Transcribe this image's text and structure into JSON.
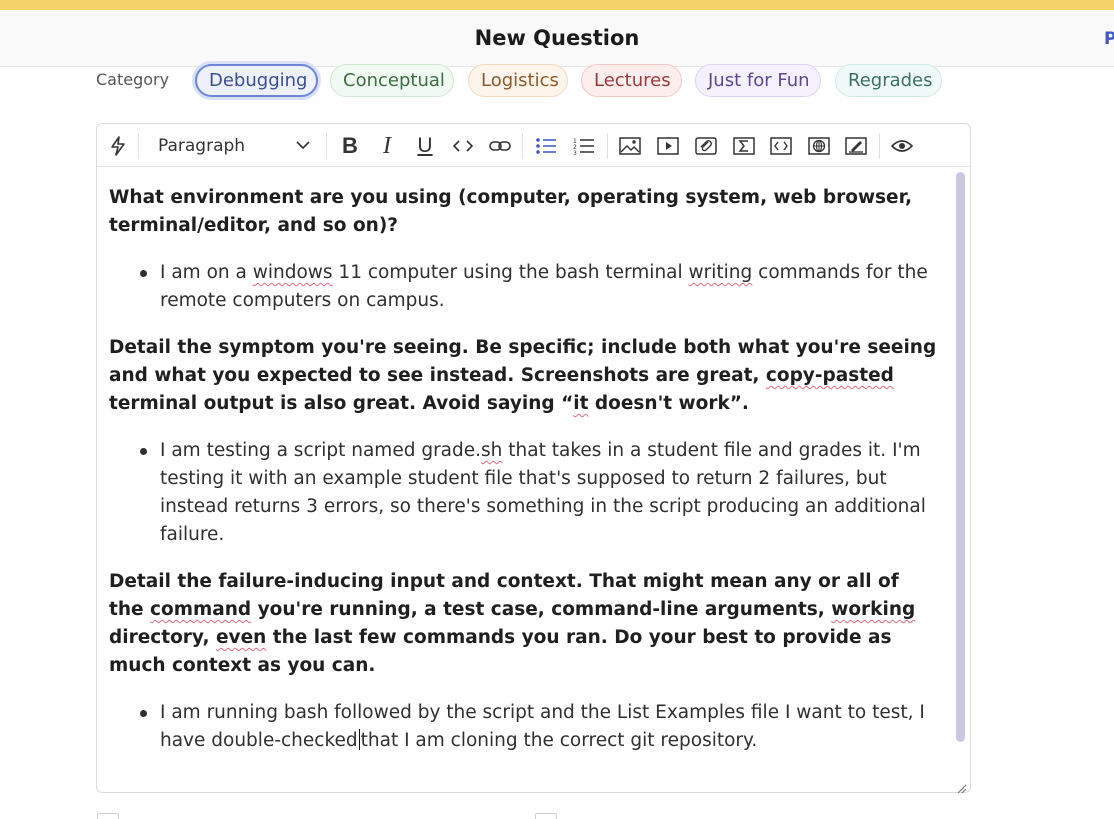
{
  "header": {
    "title": "New Question",
    "edge_letter": "P"
  },
  "category": {
    "label": "Category",
    "pills": [
      "Debugging",
      "Conceptual",
      "Logistics",
      "Lectures",
      "Just for Fun",
      "Regrades"
    ],
    "selected": "Debugging"
  },
  "toolbar": {
    "block_style": "Paragraph",
    "icons": [
      "lightning-icon",
      "bold-icon",
      "italic-icon",
      "underline-icon",
      "code-icon",
      "link-icon",
      "bullet-list-icon",
      "numbered-list-icon",
      "image-icon",
      "video-icon",
      "attachment-icon",
      "math-icon",
      "code-block-icon",
      "web-embed-icon",
      "drawing-icon",
      "preview-eye-icon"
    ]
  },
  "body": {
    "q1": "What environment are you using (computer, operating system, web browser, terminal/editor, and so on)?",
    "a1": {
      "p1": "I am on a ",
      "w1": "windows",
      "p2": " 11 computer using the bash terminal ",
      "w2": "writing",
      "p3": " commands for the remote computers on campus."
    },
    "q2": {
      "p1": "Detail the symptom you're seeing. Be specific; include both what you're seeing and what you expected to see instead. Screenshots are great, ",
      "w1": "copy-pasted",
      "p2": " terminal output is also great. Avoid saying “",
      "w2": "it",
      "p3": " doesn't work”."
    },
    "a2": {
      "p1": "I am testing a script named grade.",
      "w1": "sh",
      "p2": " that takes in a student file and grades it. I'm testing it with an example student file that's supposed to return 2 failures, but instead returns 3 errors, so there's something in the script producing an additional failure."
    },
    "q3": {
      "p1": "Detail the failure-inducing input and context. That might mean any or all of the ",
      "w1": "command",
      "p2": " you're running, a test case, command-line arguments, ",
      "w2": "working",
      "p3": " directory, ",
      "w3": "even",
      "p4": " the last few commands you ran. Do your best to provide as much context as you can."
    },
    "a3": {
      "p1": "I am running bash followed by the script and the List Examples file I want to test, I have double-checked",
      "p2": "that I am cloning the correct git repository."
    }
  }
}
